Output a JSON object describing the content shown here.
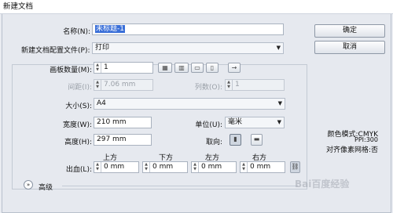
{
  "window": {
    "title": "新建文档"
  },
  "name": {
    "label": "名称(N):",
    "value": "未标题-1"
  },
  "profile": {
    "label": "新建文档配置文件(P):",
    "value": "打印"
  },
  "artboards": {
    "label": "画板数量(M):",
    "value": "1"
  },
  "spacing": {
    "label": "间距(I):",
    "value": "7.06 mm"
  },
  "columns": {
    "label": "列数(O):",
    "value": "1"
  },
  "size": {
    "label": "大小(S):",
    "value": "A4"
  },
  "width": {
    "label": "宽度(W):",
    "value": "210 mm"
  },
  "units": {
    "label": "单位(U):",
    "value": "毫米"
  },
  "height": {
    "label": "高度(H):",
    "value": "297 mm"
  },
  "orientation": {
    "label": "取向:"
  },
  "bleed": {
    "label": "出血(L):",
    "headers": [
      "上方",
      "下方",
      "左方",
      "右方"
    ],
    "values": [
      "0 mm",
      "0 mm",
      "0 mm",
      "0 mm"
    ]
  },
  "advanced": {
    "label": "高级"
  },
  "buttons": {
    "ok": "确定",
    "cancel": "取消"
  },
  "info": {
    "color_mode": "颜色模式:CMYK",
    "ppi": "PPI:300",
    "pixel_grid": "对齐像素网格:否"
  },
  "watermark": {
    "text": "Bai百度经验"
  }
}
